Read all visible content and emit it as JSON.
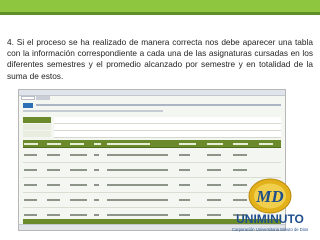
{
  "slide": {
    "instruction_text": "4. Si el proceso se ha realizado de manera correcta nos debe aparecer una tabla con la información correspondiente a cada una de las asignaturas cursadas en los diferentes semestres y el promedio alcanzado por semestre y en totalidad de la suma de estos."
  },
  "brand": {
    "logo_letters": "MD",
    "name": "UNIMINUTO",
    "tagline": "Corporación Universitaria Minuto de Dios"
  },
  "colors": {
    "accent_green": "#8fc63f",
    "dark_green": "#6a8a2b",
    "brand_gold": "#e3b21b",
    "brand_blue": "#1f4e8c"
  },
  "screenshot": {
    "table_rows": 5,
    "table_columns": 9
  }
}
